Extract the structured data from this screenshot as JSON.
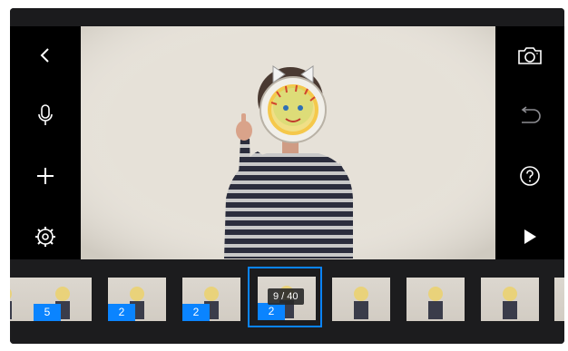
{
  "toolbar_left": {
    "icons": [
      "back-chevron-icon",
      "microphone-icon",
      "plus-icon",
      "settings-gear-icon"
    ]
  },
  "toolbar_right": {
    "icons": [
      "camera-icon",
      "undo-icon",
      "help-icon",
      "play-icon"
    ]
  },
  "timeline": {
    "frame_counter": "9 / 40",
    "thumbnails": [
      {
        "badge": ""
      },
      {
        "badge": "5"
      },
      {
        "badge": "2"
      },
      {
        "badge": "2"
      },
      {
        "badge": "2",
        "selected": true
      },
      {
        "badge": ""
      },
      {
        "badge": ""
      },
      {
        "badge": ""
      },
      {
        "badge": ""
      }
    ]
  },
  "colors": {
    "accent": "#0a84ff",
    "background": "#000000",
    "timeline_bg": "#1c1c1e",
    "status_dot": "#2ad150"
  }
}
